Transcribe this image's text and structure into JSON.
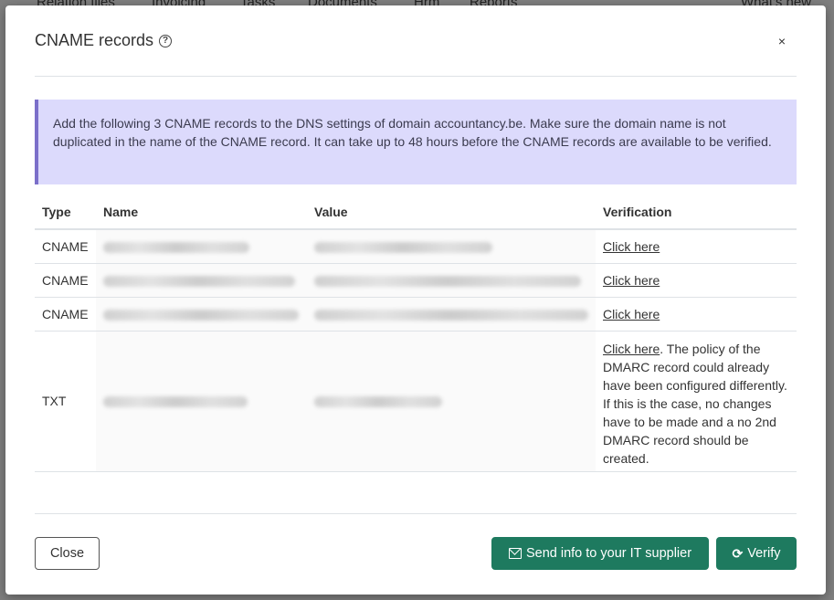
{
  "background": {
    "nav_items": [
      "Relation files",
      "Invoicing",
      "Tasks",
      "Documents",
      "Hrm",
      "Reports",
      "What's new"
    ]
  },
  "modal": {
    "title": "CNAME records",
    "help_icon": "question-circle-icon",
    "close_symbol": "×",
    "alert_text": "Add the following 3 CNAME records to the DNS settings of domain accountancy.be. Make sure the domain name is not duplicated in the name of the CNAME record. It can take up to 48 hours before the CNAME records are available to be verified.",
    "table": {
      "headers": [
        "Type",
        "Name",
        "Value",
        "Verification"
      ],
      "rows": [
        {
          "type": "CNAME",
          "verification_link": "Click here",
          "verification_note": ""
        },
        {
          "type": "CNAME",
          "verification_link": "Click here",
          "verification_note": ""
        },
        {
          "type": "CNAME",
          "verification_link": "Click here",
          "verification_note": ""
        },
        {
          "type": "TXT",
          "verification_link": "Click here",
          "verification_note": ". The policy of the DMARC record could already have been configured differently. If this is the case, no changes have to be made and a no 2nd DMARC record should be created."
        }
      ]
    },
    "buttons": {
      "close": "Close",
      "send": "Send info to your IT supplier",
      "send_icon": "envelope-icon",
      "verify": "Verify",
      "verify_icon": "sync-icon"
    }
  },
  "colors": {
    "primary": "#1e7a5f",
    "alert_bg": "#dcdafc",
    "alert_border": "#7b6fc9"
  }
}
